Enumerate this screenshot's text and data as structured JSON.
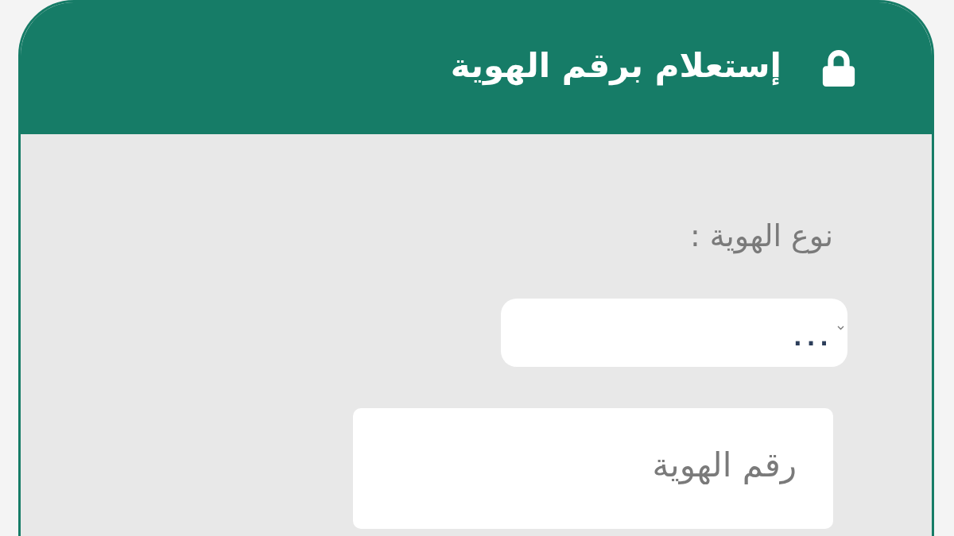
{
  "header": {
    "title": "إستعلام برقم الهوية"
  },
  "form": {
    "id_type": {
      "label": "نوع الهوية :",
      "value": "..."
    },
    "id_number": {
      "placeholder": "رقم الهوية"
    }
  }
}
